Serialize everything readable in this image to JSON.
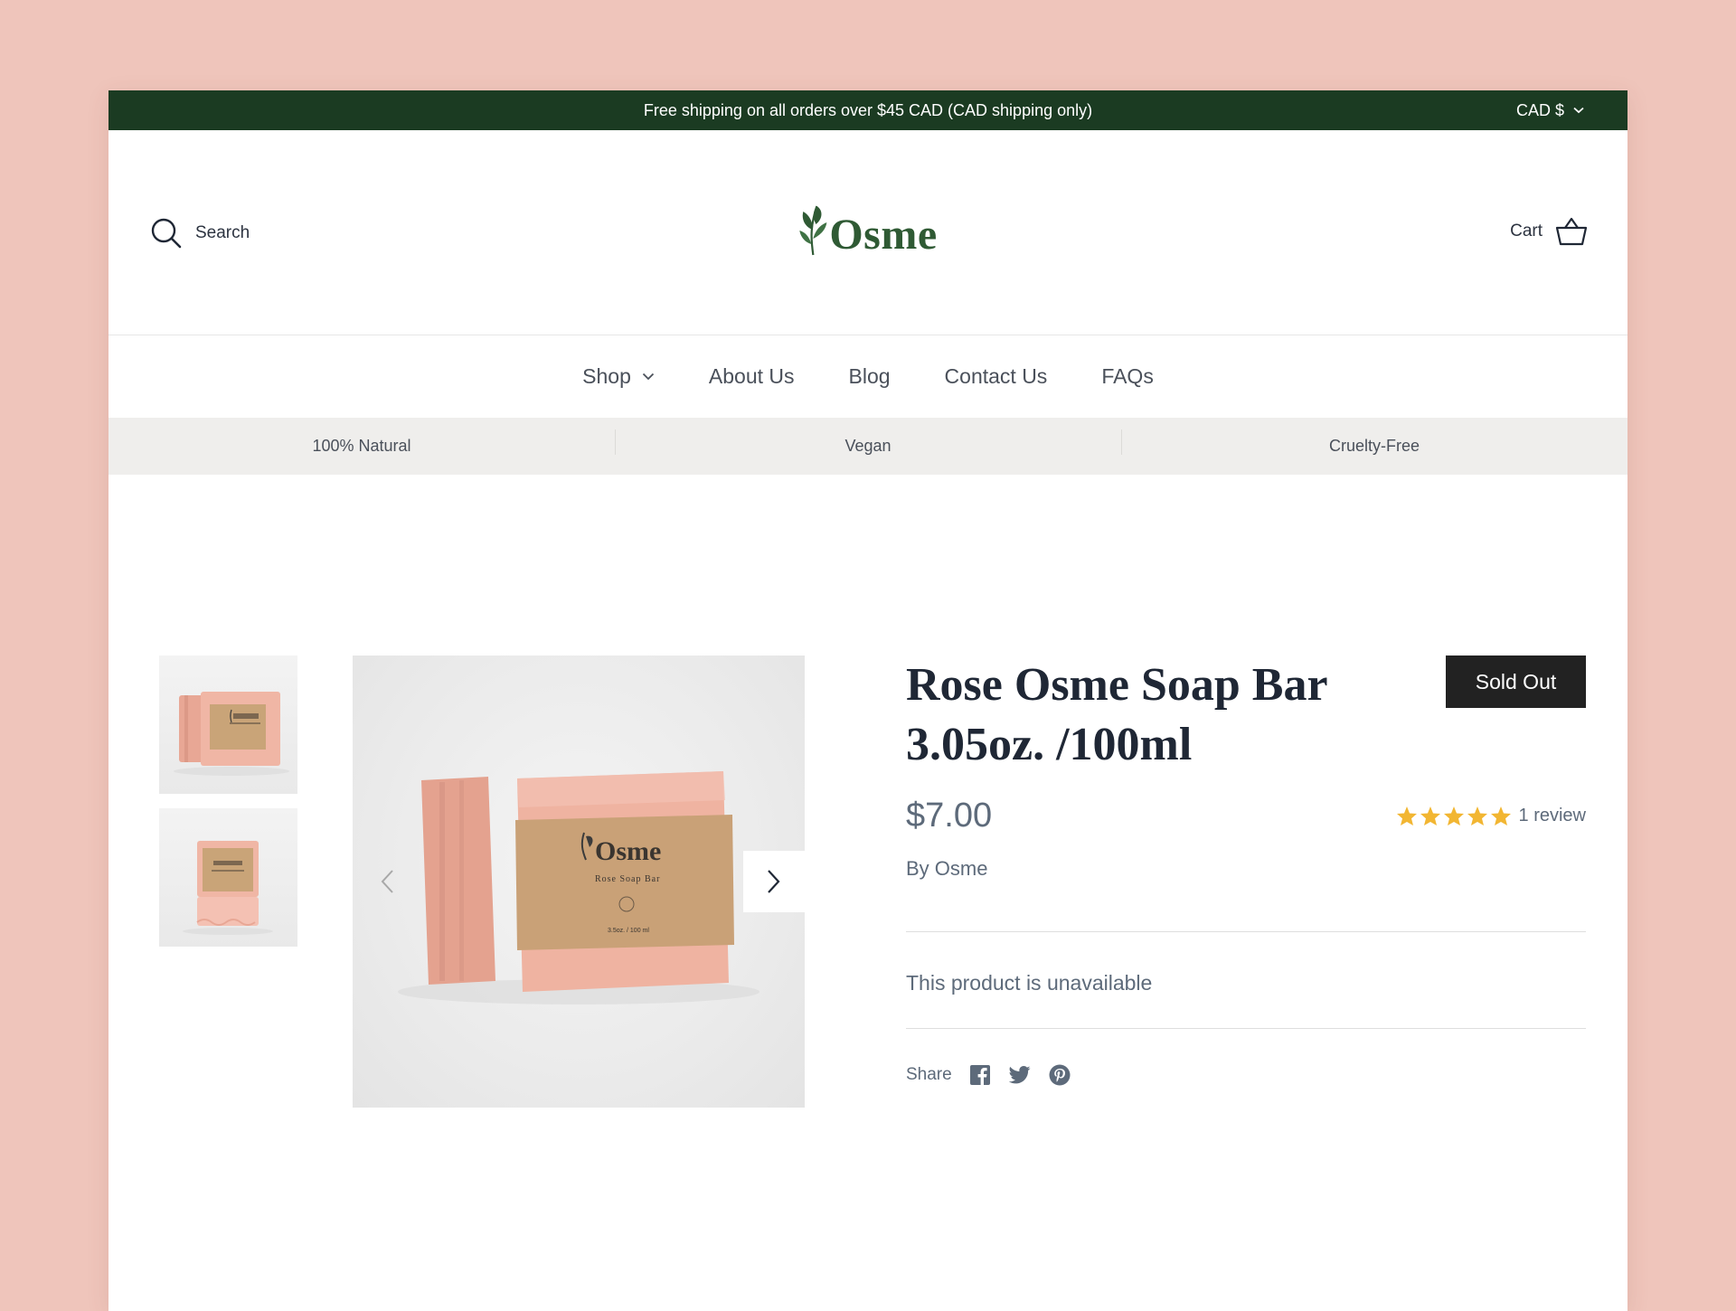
{
  "announcement": {
    "text": "Free shipping on all orders over $45 CAD (CAD shipping only)",
    "currency": "CAD $"
  },
  "header": {
    "search_label": "Search",
    "logo_text": "Osme",
    "cart_label": "Cart"
  },
  "nav": {
    "items": [
      {
        "label": "Shop",
        "has_dropdown": true
      },
      {
        "label": "About Us"
      },
      {
        "label": "Blog"
      },
      {
        "label": "Contact Us"
      },
      {
        "label": "FAQs"
      }
    ]
  },
  "usp": [
    "100% Natural",
    "Vegan",
    "Cruelty-Free"
  ],
  "product": {
    "title": "Rose Osme Soap Bar 3.05oz. /100ml",
    "badge": "Sold Out",
    "price": "$7.00",
    "rating_stars": 5,
    "review_text": "1 review",
    "vendor": "By Osme",
    "availability": "This product is unavailable",
    "share_label": "Share",
    "label_brand": "Osme",
    "label_name": "Rose Soap Bar",
    "label_size": "3.5oz. / 100 ml"
  },
  "colors": {
    "page_bg": "#efc5bb",
    "announce_bg": "#1b3b22",
    "brand_green": "#2f5a34",
    "star": "#f2b632",
    "badge_bg": "#222222"
  }
}
